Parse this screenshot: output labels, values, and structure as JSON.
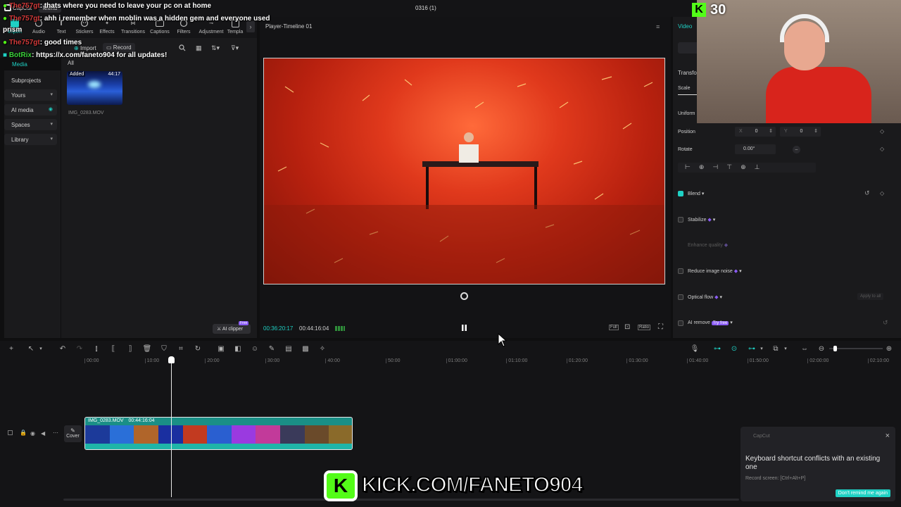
{
  "titlebar": {
    "app_name": "CapCut",
    "menu_label": "Menu",
    "project_title": "0316 (1)"
  },
  "toolbar": {
    "items": [
      "Import",
      "Audio",
      "Text",
      "Stickers",
      "Effects",
      "Transitions",
      "Captions",
      "Filters",
      "Adjustment",
      "Templa"
    ]
  },
  "media": {
    "import_label": "Import",
    "record_label": "Record",
    "all_label": "All",
    "nav_media": "Media",
    "nav": [
      {
        "label": "Subprojects"
      },
      {
        "label": "Yours"
      },
      {
        "label": "AI media"
      },
      {
        "label": "Spaces"
      },
      {
        "label": "Library"
      }
    ],
    "clip": {
      "badge": "Added",
      "duration": "44:17",
      "name": "IMG_0283.MOV"
    },
    "ai_clipper": "AI clipper",
    "free_badge": "Free"
  },
  "player": {
    "title": "Player-Timeline 01",
    "current_time": "00:36:20:17",
    "total_time": "00:44:16:04",
    "full_label": "Full",
    "ratio_label": "Ratio"
  },
  "inspector": {
    "tab_video": "Video",
    "transform": "Transfo",
    "scale": "Scale",
    "uniform": "Uniform",
    "position": "Position",
    "pos_x_label": "X",
    "pos_x": "0",
    "pos_y_label": "Y",
    "pos_y": "0",
    "rotate": "Rotate",
    "rotate_value": "0.00°",
    "blend": "Blend",
    "stabilize": "Stabilize",
    "enhance": "Enhance quality",
    "reduce_noise": "Reduce image noise",
    "optical_flow": "Optical flow",
    "apply_all": "Apply to all",
    "ai_remove": "AI remove",
    "try_free": "Try free"
  },
  "timeline": {
    "ticks": [
      "00:00",
      "10:00",
      "20:00",
      "30:00",
      "40:00",
      "50:00",
      "01:00:00",
      "01:10:00",
      "01:20:00",
      "01:30:00",
      "01:40:00",
      "01:50:00",
      "02:00:00",
      "02:10:00"
    ],
    "cover_label": "Cover",
    "clip_name": "IMG_0283.MOV",
    "clip_duration": "00:44:16:04",
    "playhead_fraction": 0.385
  },
  "toast": {
    "app": "CapCut",
    "message": "Keyboard shortcut conflicts with an existing one",
    "detail": "Record screen: [Ctrl+Alt+P]",
    "button": "Don't remind me again"
  },
  "overlay": {
    "kick_count": "30",
    "kick_url": "KICK.COM/FANETO904",
    "prism": "prism",
    "chat": [
      {
        "user": "The757gt",
        "msg": ": thats where you need to leave your pc on at home"
      },
      {
        "user": "The757gt",
        "msg": ": ahh i remember when moblin was a hidden gem and everyone used"
      },
      {
        "user": "The757gt",
        "msg": ": good times"
      },
      {
        "user": "BotRix",
        "msg": ": https://x.com/faneto904 for all updates!"
      }
    ]
  },
  "colors": {
    "accent_teal": "#1fd1c4",
    "kick_green": "#53fc18",
    "purple": "#8b5cf6",
    "clip_teal": "#1a8f86"
  }
}
